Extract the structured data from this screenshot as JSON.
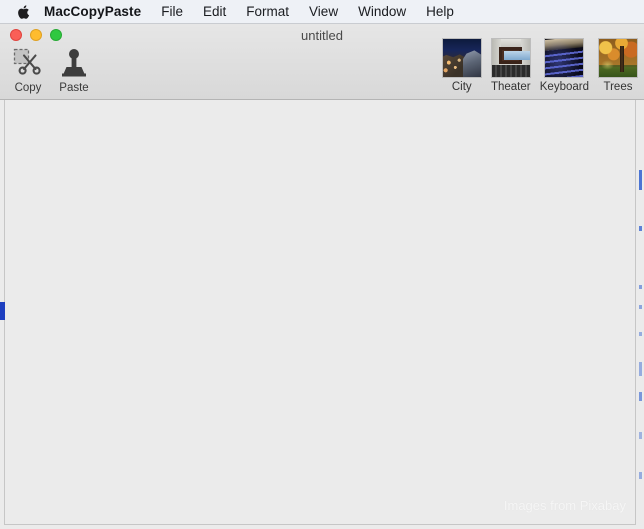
{
  "menubar": {
    "apple_icon": "apple-logo-icon",
    "app_name": "MacCopyPaste",
    "items": [
      {
        "label": "File"
      },
      {
        "label": "Edit"
      },
      {
        "label": "Format"
      },
      {
        "label": "View"
      },
      {
        "label": "Window"
      },
      {
        "label": "Help"
      }
    ]
  },
  "window": {
    "title": "untitled",
    "traffic_lights": {
      "close": {
        "name": "close-button",
        "color": "#fa5f57"
      },
      "minimize": {
        "name": "minimize-button",
        "color": "#febc2e"
      },
      "maximize": {
        "name": "maximize-button",
        "color": "#2fc840"
      }
    }
  },
  "toolbar": {
    "actions": [
      {
        "label": "Copy",
        "icon": "scissors-icon"
      },
      {
        "label": "Paste",
        "icon": "stamp-icon"
      }
    ],
    "thumbnails": [
      {
        "label": "City",
        "icon": "city-thumbnail"
      },
      {
        "label": "Theater",
        "icon": "theater-thumbnail"
      },
      {
        "label": "Keyboard",
        "icon": "keyboard-thumbnail"
      },
      {
        "label": "Trees",
        "icon": "trees-thumbnail"
      }
    ]
  },
  "document": {
    "body_text": "",
    "watermark": "Images from Pixabay",
    "background_color": "#ebebeb",
    "selection_color": "#1d3fc0"
  }
}
